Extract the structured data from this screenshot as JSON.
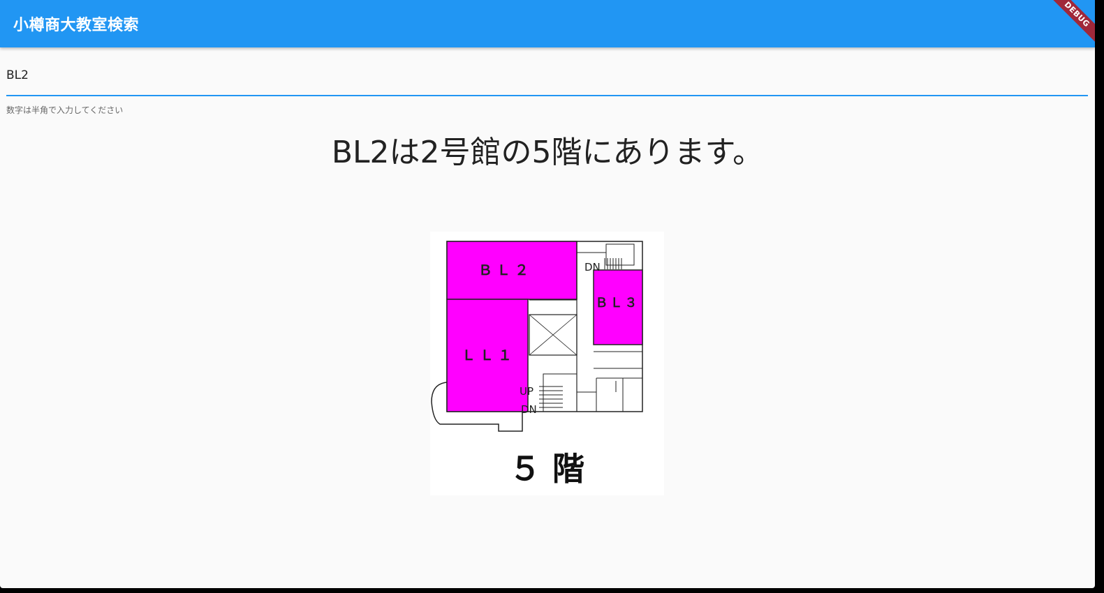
{
  "app": {
    "title": "小樽商大教室検索",
    "debug_banner": "DEBUG"
  },
  "search": {
    "value": "BL2",
    "helper": "数字は半角で入力してください"
  },
  "result": {
    "text": "BL2は2号館の5階にあります。"
  },
  "floor_map": {
    "rooms": [
      "ＢＬ２",
      "ＬＬ１",
      "ＢＬ３"
    ],
    "stair_labels": [
      "DN",
      "UP",
      "DN"
    ],
    "floor_label": "５ 階",
    "highlight_color": "#ff00ff"
  }
}
